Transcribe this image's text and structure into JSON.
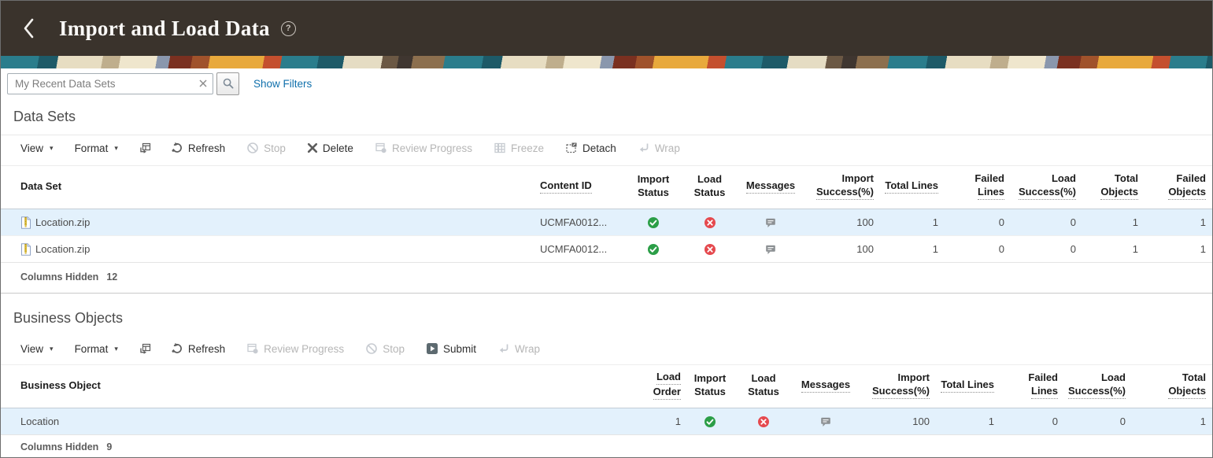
{
  "colors": {
    "header_bg": "#3a332c",
    "link_blue": "#1070ac",
    "cell_link_blue": "#1d6f9f",
    "status_success_green": "#2b9e47",
    "status_error_red": "#e5494e",
    "selected_row_bg": "#e3f1fc"
  },
  "app_header": {
    "title": "Import and Load Data",
    "help_glyph": "?"
  },
  "search": {
    "value": "My Recent Data Sets",
    "show_filters": "Show Filters"
  },
  "ds": {
    "heading": "Data Sets",
    "toolbar": {
      "view": "View",
      "format": "Format",
      "refresh": "Refresh",
      "stop": "Stop",
      "delete": "Delete",
      "review_progress": "Review Progress",
      "freeze": "Freeze",
      "detach": "Detach",
      "wrap": "Wrap"
    },
    "columns": [
      {
        "lines": [
          "Data Set"
        ]
      },
      {
        "lines": [
          "Content ID"
        ]
      },
      {
        "lines": [
          "Import",
          "Status"
        ]
      },
      {
        "lines": [
          "Load",
          "Status"
        ]
      },
      {
        "lines": [
          "Messages"
        ]
      },
      {
        "lines": [
          "Import",
          "Success(%)"
        ]
      },
      {
        "lines": [
          "Total Lines"
        ]
      },
      {
        "lines": [
          "Failed",
          "Lines"
        ]
      },
      {
        "lines": [
          "Load",
          "Success(%)"
        ]
      },
      {
        "lines": [
          "Total",
          "Objects"
        ]
      },
      {
        "lines": [
          "Failed",
          "Objects"
        ]
      }
    ],
    "rows": [
      {
        "file": "Location.zip",
        "content_id": "UCMFA0012...",
        "import_status": "success",
        "load_status": "error",
        "has_messages": true,
        "import_success": "100",
        "total_lines": "1",
        "failed_lines": "0",
        "load_success": "0",
        "total_objects": "1",
        "failed_objects": "1"
      },
      {
        "file": "Location.zip",
        "content_id": "UCMFA0012...",
        "import_status": "success",
        "load_status": "error",
        "has_messages": true,
        "import_success": "100",
        "total_lines": "1",
        "failed_lines": "0",
        "load_success": "0",
        "total_objects": "1",
        "failed_objects": "1"
      }
    ],
    "columns_hidden_label": "Columns Hidden",
    "columns_hidden_count": "12"
  },
  "bo": {
    "heading": "Business Objects",
    "toolbar": {
      "view": "View",
      "format": "Format",
      "refresh": "Refresh",
      "review_progress": "Review Progress",
      "stop": "Stop",
      "submit": "Submit",
      "wrap": "Wrap"
    },
    "columns": [
      {
        "lines": [
          "Business Object"
        ]
      },
      {
        "lines": [
          "Load",
          "Order"
        ]
      },
      {
        "lines": [
          "Import",
          "Status"
        ]
      },
      {
        "lines": [
          "Load",
          "Status"
        ]
      },
      {
        "lines": [
          "Messages"
        ]
      },
      {
        "lines": [
          "Import",
          "Success(%)"
        ]
      },
      {
        "lines": [
          "Total Lines"
        ]
      },
      {
        "lines": [
          "Failed",
          "Lines"
        ]
      },
      {
        "lines": [
          "Load",
          "Success(%)"
        ]
      },
      {
        "lines": [
          "Total",
          "Objects"
        ]
      }
    ],
    "row": {
      "name": "Location",
      "load_order": "1",
      "import_status": "success",
      "load_status": "error",
      "has_messages": true,
      "import_success": "100",
      "total_lines": "1",
      "failed_lines": "0",
      "load_success": "0",
      "total_objects": "1"
    },
    "columns_hidden_label": "Columns Hidden",
    "columns_hidden_count": "9"
  }
}
